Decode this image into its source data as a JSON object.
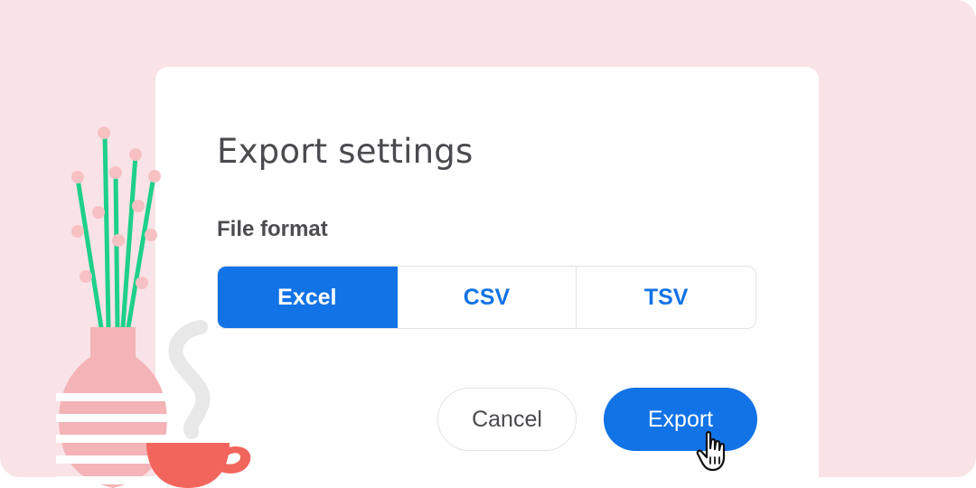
{
  "dialog": {
    "title": "Export settings",
    "file_format_label": "File format",
    "formats": [
      {
        "label": "Excel",
        "selected": true
      },
      {
        "label": "CSV",
        "selected": false
      },
      {
        "label": "TSV",
        "selected": false
      }
    ],
    "cancel_label": "Cancel",
    "export_label": "Export"
  },
  "colors": {
    "accent": "#1273e6",
    "backdrop": "#f9e3e6",
    "dialog_bg": "#ffffff",
    "text_dark": "#4a4a4f",
    "stem_green": "#1ed08a",
    "blossom_pink": "#f6bcc0",
    "vase_pink": "#f4b4b8",
    "cup_red": "#f2655c",
    "steam_grey": "#e6e6e6"
  },
  "icons": {
    "cursor": "hand-pointer-icon"
  }
}
